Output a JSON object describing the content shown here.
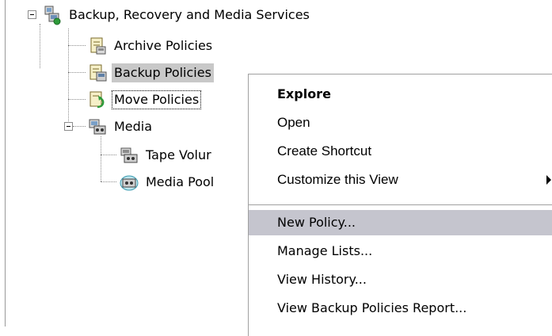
{
  "tree": {
    "root_label": "Backup, Recovery and Media Services",
    "items": [
      {
        "label": "Archive Policies",
        "icon": "archive-policy-icon"
      },
      {
        "label": "Backup Policies",
        "icon": "backup-policy-icon",
        "selected": true
      },
      {
        "label": "Move Policies",
        "icon": "move-policy-icon",
        "focused": true
      },
      {
        "label": "Media",
        "icon": "media-icon"
      }
    ],
    "media_children": [
      {
        "label": "Tape Volur",
        "icon": "tape-volume-icon"
      },
      {
        "label": "Media Pool",
        "icon": "media-pool-icon"
      }
    ]
  },
  "context_menu": {
    "items": [
      {
        "label": "Explore",
        "default": true
      },
      {
        "label": "Open"
      },
      {
        "label": "Create Shortcut"
      },
      {
        "label": "Customize this View",
        "submenu": true
      },
      {
        "label": "New Policy...",
        "highlighted": true
      },
      {
        "label": "Manage Lists..."
      },
      {
        "label": "View History..."
      },
      {
        "label": "View Backup Policies Report..."
      }
    ]
  },
  "colors": {
    "selection": "#c8c8c8",
    "menu_highlight": "#c5c5ce",
    "tree_line": "#8c8c8c"
  }
}
